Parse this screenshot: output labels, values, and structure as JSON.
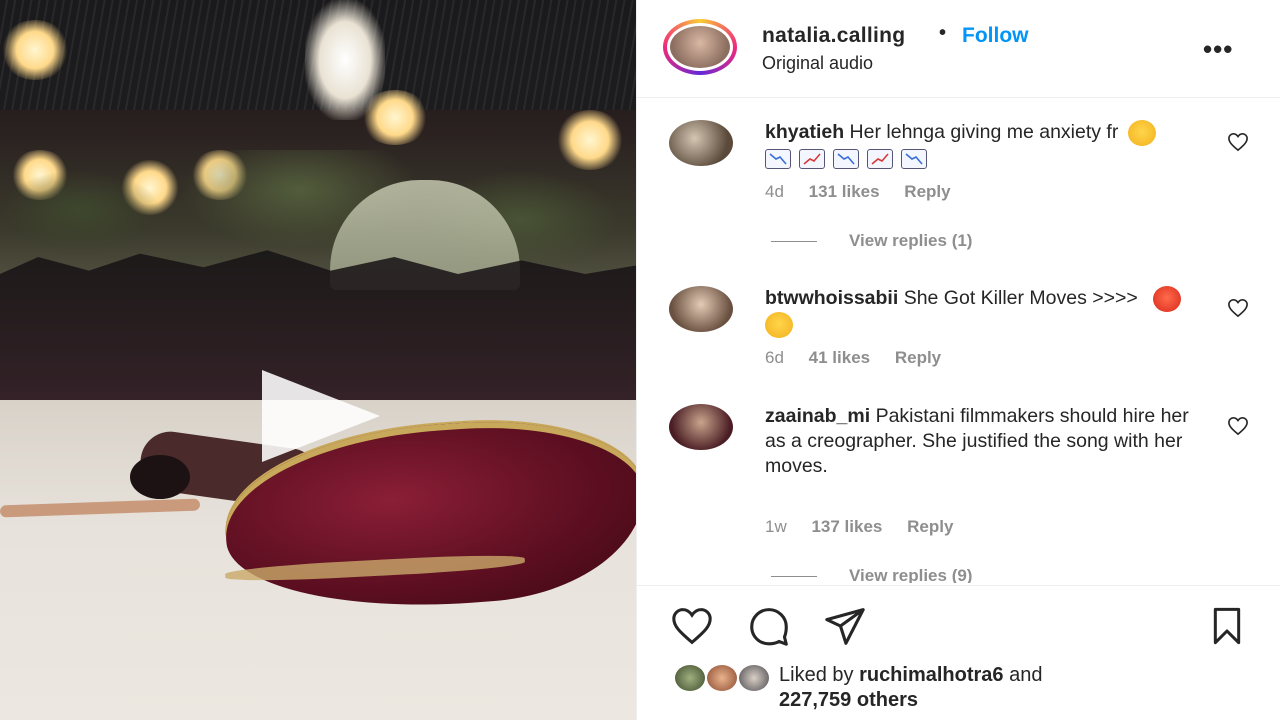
{
  "post": {
    "username": "natalia.calling",
    "separator": "•",
    "follow_label": "Follow",
    "audio_label": "Original audio",
    "more_label": "•••"
  },
  "comments": [
    {
      "username": "khyatieh",
      "text": "Her lehnga giving me anxiety fr",
      "time": "4d",
      "likes": "131 likes",
      "reply_label": "Reply",
      "view_replies": "View replies (1)"
    },
    {
      "username": "btwwhoissabii",
      "text": "She Got Killer Moves >>>>",
      "time": "6d",
      "likes": "41 likes",
      "reply_label": "Reply"
    },
    {
      "username": "zaainab_mi",
      "text": "Pakistani filmmakers should hire her as a creographer. She justified the song with her moves.",
      "time": "1w",
      "likes": "137 likes",
      "reply_label": "Reply",
      "view_replies": "View replies (9)"
    }
  ],
  "likes": {
    "prefix": "Liked by",
    "user": "ruchimalhotra6",
    "connector": "and",
    "others": "227,759 others"
  },
  "icons": {
    "like": "heart-icon",
    "comment": "comment-icon",
    "share": "paper-plane-icon",
    "save": "bookmark-icon",
    "play": "play-icon"
  },
  "colors": {
    "follow": "#0095f6",
    "meta": "#8e8e8e",
    "text": "#262626"
  }
}
